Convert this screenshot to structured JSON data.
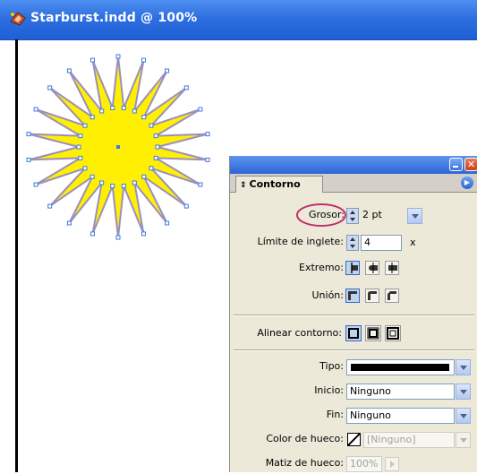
{
  "document": {
    "title": "Starburst.indd @ 100%"
  },
  "panel": {
    "tab_label": "Contorno",
    "grosor": {
      "label": "Grosor:",
      "value": "2 pt"
    },
    "limite": {
      "label": "Límite de inglete:",
      "value": "4",
      "unit": "x"
    },
    "extremo": {
      "label": "Extremo:"
    },
    "union": {
      "label": "Unión:"
    },
    "alinear": {
      "label": "Alinear contorno:"
    },
    "tipo": {
      "label": "Tipo:"
    },
    "inicio": {
      "label": "Inicio:",
      "value": "Ninguno"
    },
    "fin": {
      "label": "Fin:",
      "value": "Ninguno"
    },
    "color_hueco": {
      "label": "Color de hueco:",
      "value": "[Ninguno]"
    },
    "matiz_hueco": {
      "label": "Matiz de hueco:",
      "value": "100%"
    }
  },
  "colors": {
    "star_fill": "#ffef00",
    "star_stroke": "#9a8fc0",
    "highlight_ring": "#c2306e",
    "titlebar": "#2e6fe0"
  }
}
